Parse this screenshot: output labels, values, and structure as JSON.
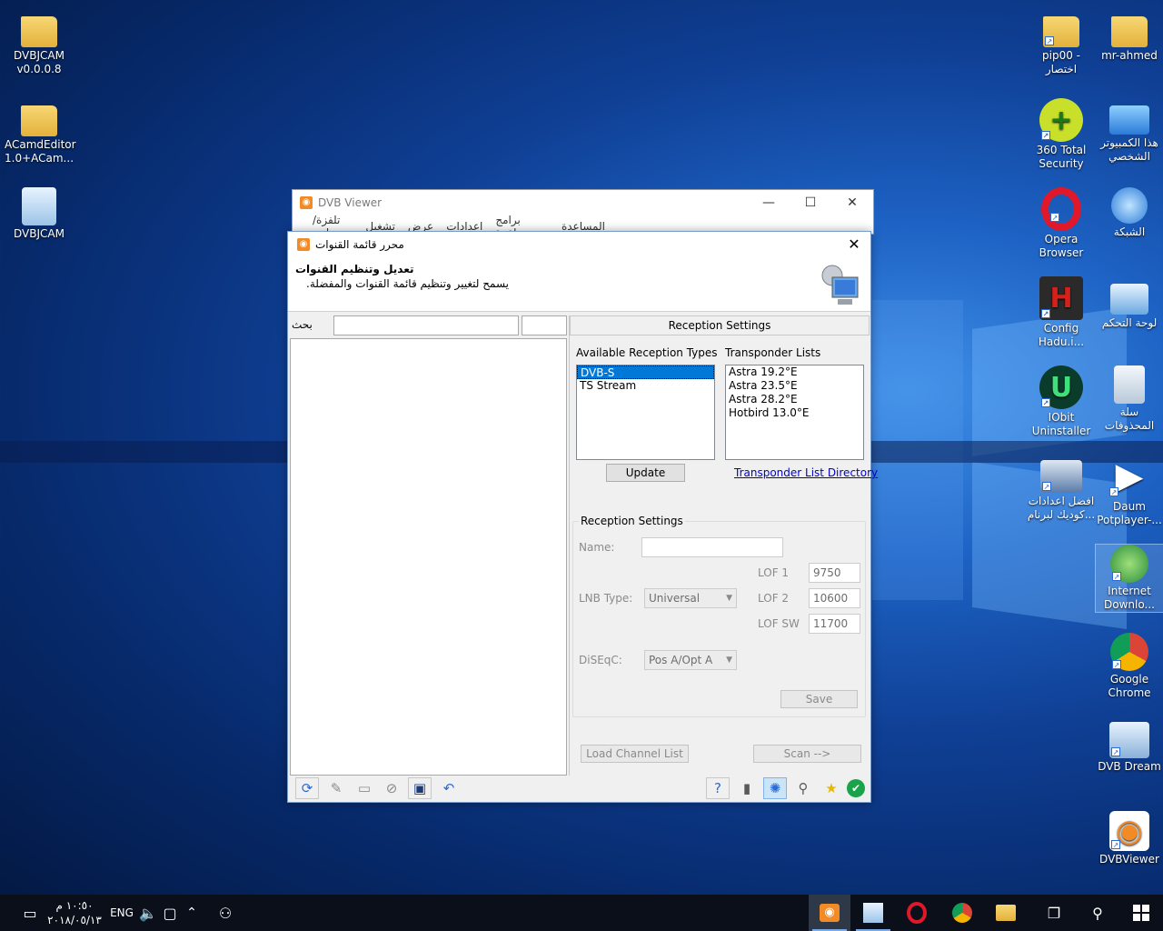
{
  "desktop": {
    "icons_left": [
      {
        "label1": "DVBJCAM",
        "label2": "v0.0.0.8",
        "icon": "folder-icon"
      },
      {
        "label1": "ACamdEditor",
        "label2": "1.0+ACam...",
        "icon": "folder-icon"
      },
      {
        "label1": "DVBJCAM",
        "label2": "",
        "icon": "notepad-icon"
      }
    ],
    "icons_right_col1": [
      {
        "label1": "pip00 -",
        "label2": "اختصار",
        "icon": "folder-icon"
      },
      {
        "label1": "360 Total",
        "label2": "Security",
        "icon": "plus-shield-icon"
      },
      {
        "label1": "Opera",
        "label2": "Browser",
        "icon": "opera-icon"
      },
      {
        "label1": "Config",
        "label2": "Hadu.i...",
        "icon": "config-icon"
      },
      {
        "label1": "IObit",
        "label2": "Uninstaller",
        "icon": "iobit-icon"
      },
      {
        "label1": "افضل اعدادات",
        "label2": "كوديك لبرنام...",
        "icon": "screenshot-icon"
      }
    ],
    "icons_right_col2": [
      {
        "label1": "mr-ahmed",
        "label2": "",
        "icon": "user-folder-icon"
      },
      {
        "label1": "هذا الكمبيوتر",
        "label2": "الشخصي",
        "icon": "computer-icon"
      },
      {
        "label1": "الشبكة",
        "label2": "",
        "icon": "network-icon"
      },
      {
        "label1": "لوحة التحكم",
        "label2": "",
        "icon": "control-panel-icon"
      },
      {
        "label1": "سلة",
        "label2": "المحذوفات",
        "icon": "recycle-bin-icon"
      },
      {
        "label1": "Daum",
        "label2": "Potplayer-...",
        "icon": "play-icon"
      },
      {
        "label1": "Internet",
        "label2": "Downlo...",
        "icon": "idm-icon"
      },
      {
        "label1": "Google",
        "label2": "Chrome",
        "icon": "chrome-icon"
      },
      {
        "label1": "DVB Dream",
        "label2": "",
        "icon": "satellite-icon"
      },
      {
        "label1": "DVBViewer",
        "label2": "",
        "icon": "dvbviewer-icon"
      }
    ]
  },
  "viewer": {
    "title": "DVB Viewer",
    "menu": [
      "تلفزة/راديو",
      "تشغيل",
      "عرض",
      "اعدادات",
      "برامج مساعدة",
      "المساعدة"
    ],
    "minimize": "—",
    "maximize": "☐",
    "close": "✕"
  },
  "dialog": {
    "title": "محرر قائمة القنوات",
    "close": "✕",
    "header_title": "تعديل وتنظيم القنوات",
    "header_subtitle": ".يسمح لتغيير وتنظيم قائمة القنوات والمفضلة",
    "search_label": "بحث",
    "search_value": "",
    "reception_header": "Reception Settings",
    "available_types_label": "Available Reception Types",
    "available_types": [
      "DVB-S",
      "TS Stream"
    ],
    "selected_type": "DVB-S",
    "transponder_lists_label": "Transponder Lists",
    "transponder_lists": [
      "Astra 19.2°E",
      "Astra 23.5°E",
      "Astra 28.2°E",
      "Hotbird 13.0°E"
    ],
    "update_button": "Update",
    "transponder_dir_link": "Transponder List Directory",
    "group_title": "Reception Settings",
    "name_label": "Name:",
    "name_value": "",
    "lnb_type_label": "LNB Type:",
    "lnb_type_value": "Universal",
    "lof1_label": "LOF 1",
    "lof1_value": "9750",
    "lof2_label": "LOF 2",
    "lof2_value": "10600",
    "lofsw_label": "LOF SW",
    "lofsw_value": "11700",
    "diseqc_label": "DiSEqC:",
    "diseqc_value": "Pos A/Opt A",
    "save_button": "Save",
    "load_channel_list_button": "Load Channel List",
    "scan_button": "Scan -->"
  },
  "taskbar": {
    "time": "١٠:٥٠ م",
    "date": "٢٠١٨/٠٥/١٣",
    "language": "ENG"
  },
  "colors": {
    "accent": "#0078d7",
    "dvb_orange": "#f28a25"
  }
}
